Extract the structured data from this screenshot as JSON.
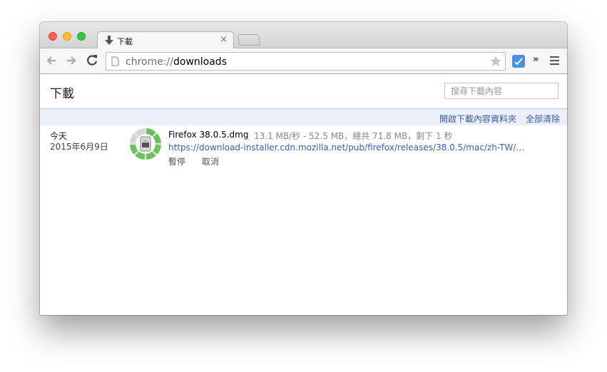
{
  "tab": {
    "title": "下載",
    "close_glyph": "×"
  },
  "toolbar": {
    "url_scheme": "chrome://",
    "url_path": "downloads",
    "overflow_glyph": "»"
  },
  "page": {
    "title": "下載",
    "search_placeholder": "搜尋下載內容"
  },
  "actions": {
    "open_folder": "開啟下載內容資料夾",
    "clear_all": "全部清除"
  },
  "downloads": [
    {
      "date_label": "今天",
      "date": "2015年6月9日",
      "file_name": "Firefox 38.0.5.dmg",
      "status": "13.1 MB/秒 - 52.5 MB，總共 71.8 MB，剩下 1 秒",
      "url": "https://download-installer.cdn.mozilla.net/pub/firefox/releases/38.0.5/mac/zh-TW/Firefox%2...",
      "pause_label": "暫停",
      "cancel_label": "取消",
      "progress": 0.73
    }
  ],
  "colors": {
    "link": "#3b57a8",
    "progress_green": "#6cc25a",
    "action_bar_bg": "#ebeff9"
  },
  "icons": [
    "download-arrow-icon",
    "close-icon",
    "back-arrow-icon",
    "forward-arrow-icon",
    "reload-icon",
    "page-icon",
    "star-icon",
    "extension-icon",
    "chevron-double-right-icon",
    "menu-icon",
    "dmg-file-icon"
  ]
}
